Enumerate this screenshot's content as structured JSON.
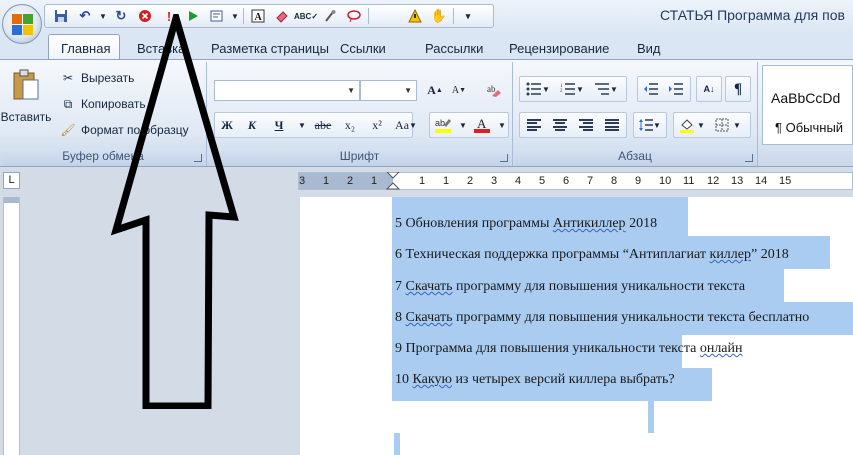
{
  "window": {
    "title": "СТАТЬЯ Программа для пов"
  },
  "quick_access": {
    "icons": [
      "save-icon",
      "undo-icon",
      "redo-icon",
      "stop-icon",
      "exclamation-icon",
      "run-icon",
      "document-map-icon",
      "text-box-icon",
      "eraser-icon",
      "spelling-icon",
      "macro-icon",
      "link-icon",
      "warning-icon",
      "hand-icon",
      "customize-icon"
    ]
  },
  "tabs": [
    "Главная",
    "Вставка",
    "Разметка страницы",
    "Ссылки",
    "Рассылки",
    "Рецензирование",
    "Вид"
  ],
  "clipboard": {
    "paste": "Вставить",
    "cut": "Вырезать",
    "copy": "Копировать",
    "format_painter": "Формат по образцу",
    "group": "Буфер обмена"
  },
  "font": {
    "group": "Шрифт",
    "bold": "Ж",
    "italic": "К",
    "underline": "Ч",
    "strike": "abe",
    "subscript": "x₂",
    "superscript": "x²",
    "case": "Aa",
    "grow": "A",
    "shrink": "A"
  },
  "paragraph": {
    "group": "Абзац",
    "show_marks": "¶"
  },
  "styles": {
    "preview": "AaBbCcDd",
    "name": "¶ Обычный"
  },
  "ruler": {
    "labels": [
      "3",
      "1",
      "2",
      "1",
      "1",
      "1",
      "2",
      "3",
      "4",
      "5",
      "6",
      "7",
      "8",
      "9",
      "10",
      "11",
      "12",
      "13",
      "14",
      "15"
    ],
    "corner": "L"
  },
  "document": {
    "lines": [
      {
        "pre": "5 Обновления программы ",
        "wavy": "Антикиллер",
        "post": " 2018"
      },
      {
        "pre": "6 Техническая поддержка программы “Антиплагиат ",
        "wavy": "киллер",
        "post": "” 2018"
      },
      {
        "pre": "7 ",
        "wavy": "Скачать",
        "post": " программу для повышения уникальности текста"
      },
      {
        "pre": "8 ",
        "wavy": "Скачать",
        "post": " программу для повышения уникальности текста бесплатно"
      },
      {
        "pre": "9 Программа  для повышения уникальности текста ",
        "wavy": "онлайн",
        "post": ""
      },
      {
        "pre": "10 ",
        "wavy": "Какую",
        "post": " из четырех версий киллера выбрать?"
      }
    ]
  },
  "colors": {
    "selection": "#a9ccf0",
    "ribbon": "#dfe8f4",
    "accent_red": "#e02020",
    "highlight_yellow": "#ffff00"
  }
}
